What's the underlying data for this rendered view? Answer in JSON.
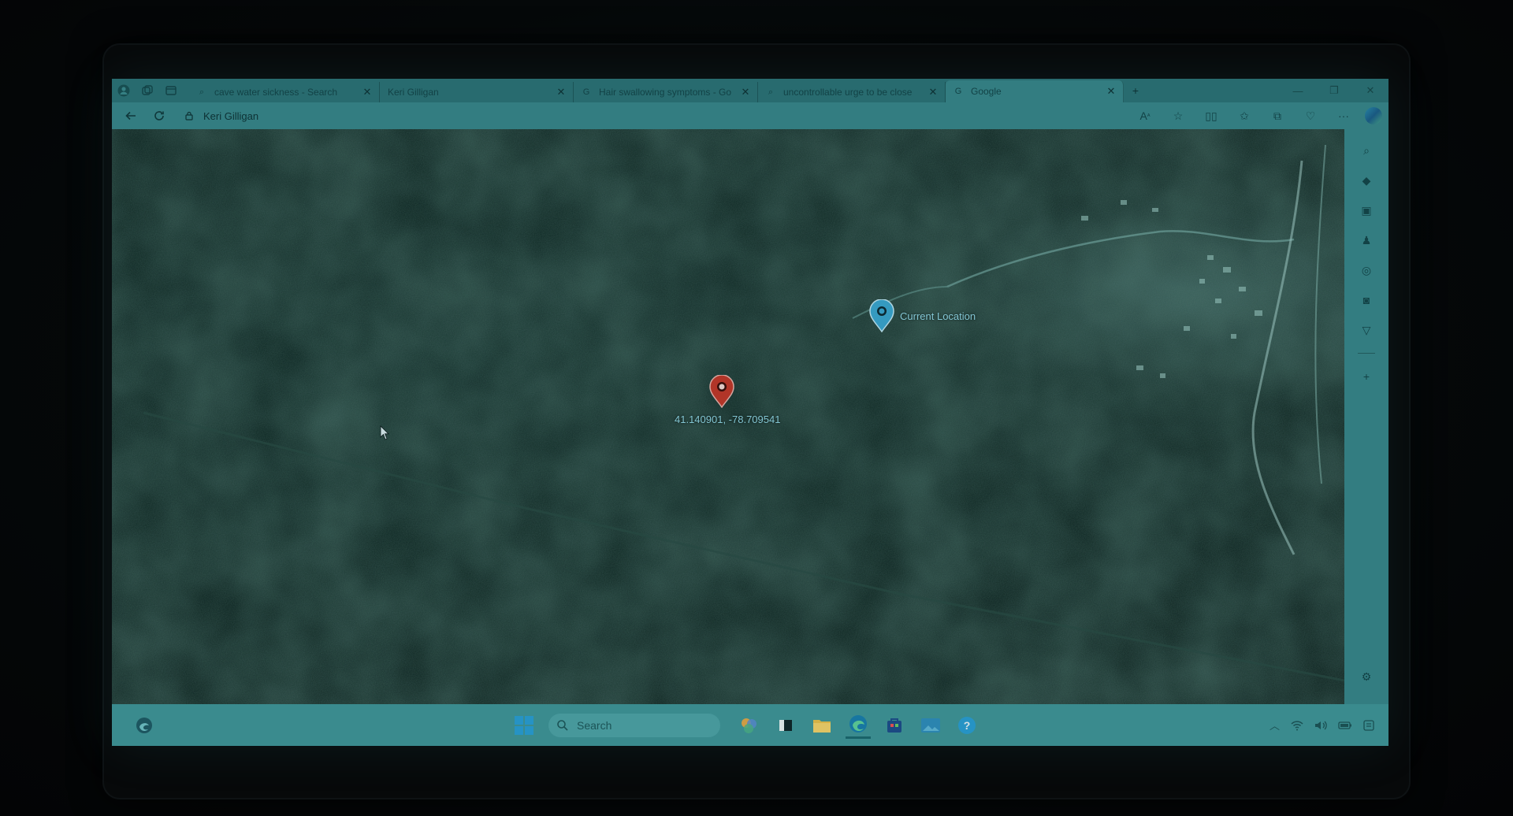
{
  "browser": {
    "tabs": [
      {
        "label": "cave water sickness - Search",
        "icon": "search-icon"
      },
      {
        "label": "Keri Gilligan",
        "icon": "page-icon"
      },
      {
        "label": "Hair swallowing symptoms - Go",
        "icon": "google-icon"
      },
      {
        "label": "uncontrollable urge to be close",
        "icon": "search-icon"
      },
      {
        "label": "Google",
        "icon": "google-icon"
      }
    ],
    "active_tab_index": 4,
    "address": "Keri Gilligan"
  },
  "map": {
    "current_location_label": "Current Location",
    "target_coordinates": "41.140901, -78.709541"
  },
  "taskbar": {
    "search_placeholder": "Search"
  },
  "colors": {
    "screen_tint": "#2c7478",
    "map_forest": "#0b231f",
    "current_pin": "#3aa6d0",
    "target_pin": "#c0392b",
    "pin_label": "#8fd6e4"
  }
}
